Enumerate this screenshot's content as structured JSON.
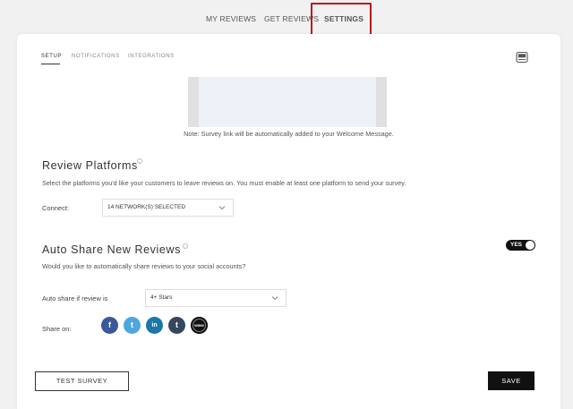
{
  "top_nav": {
    "my_reviews": "MY REVIEWS",
    "get_reviews": "GET REVIEWS",
    "settings": "SETTINGS"
  },
  "sub_tabs": {
    "setup": "SETUP",
    "notifications": "NOTIFICATIONS",
    "integrations": "INTEGRATIONS"
  },
  "note": "Note: Survey link will be automatically added to your Welcome Message.",
  "review_platforms": {
    "title": "Review Platforms",
    "description": "Select the platforms you'd like your customers to leave reviews on. You must enable at least one platform to send your survey.",
    "connect_label": "Connect:",
    "connect_value": "14 NETWORK(S) SELECTED"
  },
  "auto_share": {
    "title": "Auto Share New Reviews",
    "description": "Would you like to automatically share reviews to your social accounts?",
    "toggle_label": "YES",
    "toggle_on": true,
    "auto_share_label": "Auto share if review is",
    "auto_share_value": "4+ Stars",
    "share_on_label": "Share on:",
    "networks": [
      {
        "name": "facebook",
        "glyph": "f",
        "color": "#3b5998"
      },
      {
        "name": "twitter",
        "glyph": "t",
        "color": "#4da7de"
      },
      {
        "name": "linkedin",
        "glyph": "in",
        "color": "#1a77a8"
      },
      {
        "name": "tumblr",
        "glyph": "t",
        "color": "#36465d"
      },
      {
        "name": "website",
        "glyph": "www",
        "color": "#111111"
      }
    ]
  },
  "buttons": {
    "test_survey": "TEST SURVEY",
    "save": "SAVE"
  },
  "colors": {
    "highlight": "#c0121b",
    "primary_dark": "#111111"
  }
}
